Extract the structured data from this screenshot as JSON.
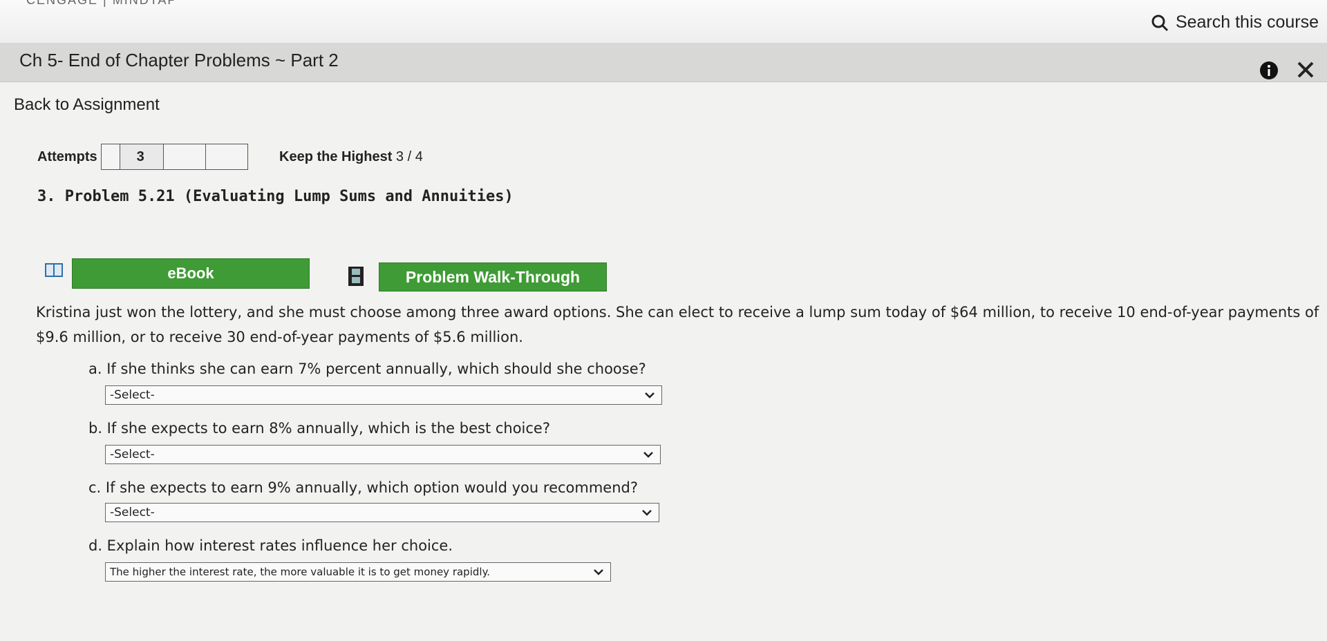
{
  "header": {
    "brand": "CENGAGE | MINDTAP",
    "search_label": "Search this course"
  },
  "titlebar": {
    "title": "Ch 5- End of Chapter Problems ~ Part 2"
  },
  "nav": {
    "back_label": "Back to Assignment"
  },
  "attempts": {
    "label": "Attempts",
    "value": "3",
    "keep_label": "Keep the Highest",
    "score": "3 / 4"
  },
  "problem": {
    "title": "3.  Problem 5.21 (Evaluating Lump Sums and Annuities)",
    "ebook_label": "eBook",
    "walkthrough_label": "Problem Walk-Through",
    "text": "Kristina just won the lottery, and she must choose among three award options. She can elect to receive a lump sum today of $64 million, to receive 10 end-of-year payments of $9.6 million, or to receive 30 end-of-year payments of $5.6 million.",
    "parts": [
      {
        "question": "a. If she thinks she can earn 7% percent annually, which should she choose?",
        "selected": "-Select-"
      },
      {
        "question": "b. If she expects to earn 8% annually, which is the best choice?",
        "selected": "-Select-"
      },
      {
        "question": "c. If she expects to earn 9% annually, which option would you recommend?",
        "selected": "-Select-"
      },
      {
        "question": "d. Explain how interest rates influence her choice.",
        "selected": "The higher the interest rate, the more valuable it is to get money rapidly."
      }
    ]
  },
  "colors": {
    "button_green": "#3f9b35",
    "title_bar": "#d8d8d6"
  }
}
